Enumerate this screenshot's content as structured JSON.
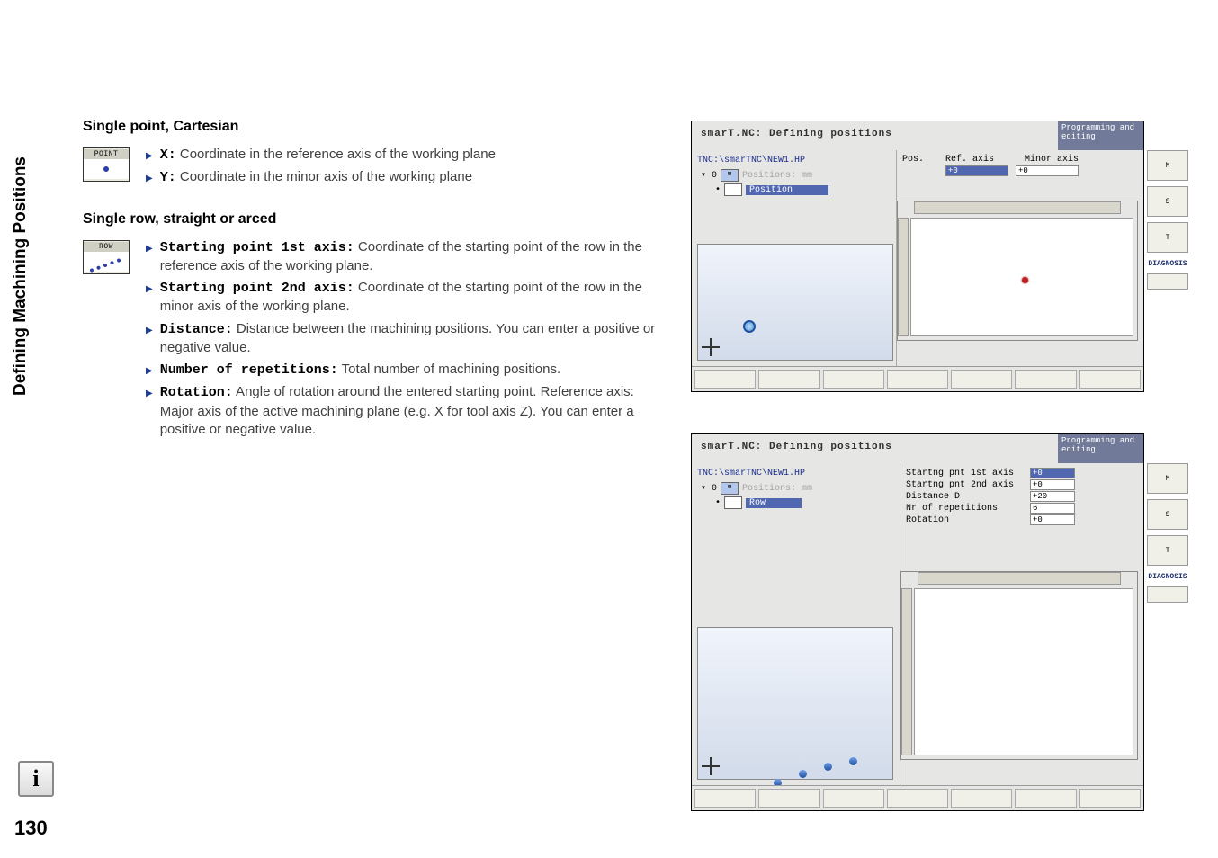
{
  "sidebar": {
    "section_title": "Defining Machining Positions"
  },
  "page_number": "130",
  "section1": {
    "heading": "Single point, Cartesian",
    "icon_label": "POINT",
    "items": [
      {
        "kw": "X:",
        "text": " Coordinate in the reference axis of the working plane"
      },
      {
        "kw": "Y:",
        "text": " Coordinate in the minor axis of the working plane"
      }
    ]
  },
  "section2": {
    "heading": "Single row, straight or arced",
    "icon_label": "ROW",
    "items": [
      {
        "kw": "Starting point 1st axis:",
        "text": " Coordinate of the starting point of the row in the reference axis of the working plane."
      },
      {
        "kw": "Starting point 2nd axis:",
        "text": " Coordinate of the starting point of the row in the minor axis of the working plane."
      },
      {
        "kw": "Distance:",
        "text": " Distance between the machining positions. You can enter a positive or negative value."
      },
      {
        "kw": "Number of repetitions:",
        "text": " Total number of machining positions."
      },
      {
        "kw": "Rotation:",
        "text": " Angle of rotation around the entered starting point. Reference axis: Major axis of the active machining plane (e.g. X for tool axis Z). You can enter a positive or negative value."
      }
    ]
  },
  "screenshot1": {
    "title": "smarT.NC: Defining positions",
    "mode": "Programming and editing",
    "path": "TNC:\\smarTNC\\NEW1.HP",
    "tree_root": "Positions: mm",
    "tree_sel": "Position",
    "hdr_pos": "Pos.",
    "hdr_ref": "Ref. axis",
    "hdr_min": "Minor axis",
    "val_ref": "+0",
    "val_min": "+0",
    "diag": "DIAGNOSIS",
    "rt_m": "M",
    "rt_s": "S",
    "rt_t": "T"
  },
  "screenshot2": {
    "title": "smarT.NC: Defining positions",
    "mode": "Programming and editing",
    "path": "TNC:\\smarTNC\\NEW1.HP",
    "tree_root": "Positions: mm",
    "tree_sel": "Row",
    "f1": "Startng pnt 1st axis",
    "f2": "Startng pnt 2nd axis",
    "f3": "Distance D",
    "f4": "Nr of repetitions",
    "f5": "Rotation",
    "v1": "+0",
    "v2": "+0",
    "v3": "+20",
    "v4": "6",
    "v5": "+0",
    "diag": "DIAGNOSIS",
    "rt_m": "M",
    "rt_s": "S",
    "rt_t": "T"
  }
}
